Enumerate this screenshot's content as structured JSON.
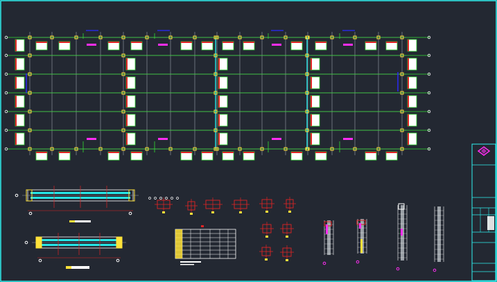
{
  "colors": {
    "background": "#232832",
    "border": "#2ff0f0",
    "grid": "#8a8f99",
    "axis": "#33dd33",
    "node": "#ffe23a",
    "white": "#ffffff",
    "red": "#e02424",
    "magenta": "#ff2df2",
    "blue": "#2a2aff",
    "cyan": "#25e6e6",
    "gray": "#9aa0a6"
  },
  "title_block": {
    "logo_icon": "company-logo-icon"
  }
}
